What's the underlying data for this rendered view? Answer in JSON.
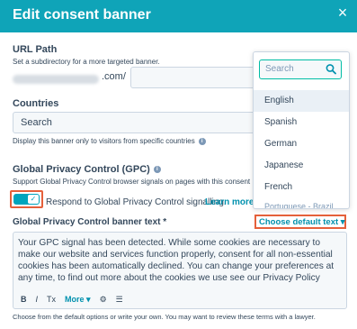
{
  "header": {
    "title": "Edit consent banner",
    "close_label": "×"
  },
  "url_path": {
    "label": "URL Path",
    "help": "Set a subdirectory for a more targeted banner.",
    "domain_suffix": ".com/",
    "value": ""
  },
  "countries": {
    "label": "Countries",
    "search_text": "Search",
    "help": "Display this banner only to visitors from specific countries"
  },
  "gpc": {
    "label": "Global Privacy Control (GPC)",
    "help": "Support Global Privacy Control browser signals on pages with this consent",
    "toggle_on": true,
    "toggle_text": "Respond to Global Privacy Control signalling.",
    "learn_more": "Learn more."
  },
  "banner_text": {
    "label": "Global Privacy Control banner text *",
    "choose_default": "Choose default text",
    "value": "Your GPC signal has been detected. While some cookies are necessary to make our website and services function properly, consent for all non-essential cookies has been automatically declined. You can change your preferences at any time, to find out more about the cookies we use see our Privacy Policy",
    "toolbar": {
      "bold": "B",
      "italic": "I",
      "clear": "Tx",
      "more": "More"
    },
    "footer_help": "Choose from the default options or write your own. You may want to review these terms with a lawyer."
  },
  "dropdown": {
    "search_placeholder": "Search",
    "options": [
      "English",
      "Spanish",
      "German",
      "Japanese",
      "French",
      "Portuguese - Brazil"
    ],
    "highlighted": "English"
  },
  "colors": {
    "header": "#0fa4b8",
    "accent": "#00a4bd",
    "highlight_border": "#e5603b",
    "link": "#0091ae"
  }
}
